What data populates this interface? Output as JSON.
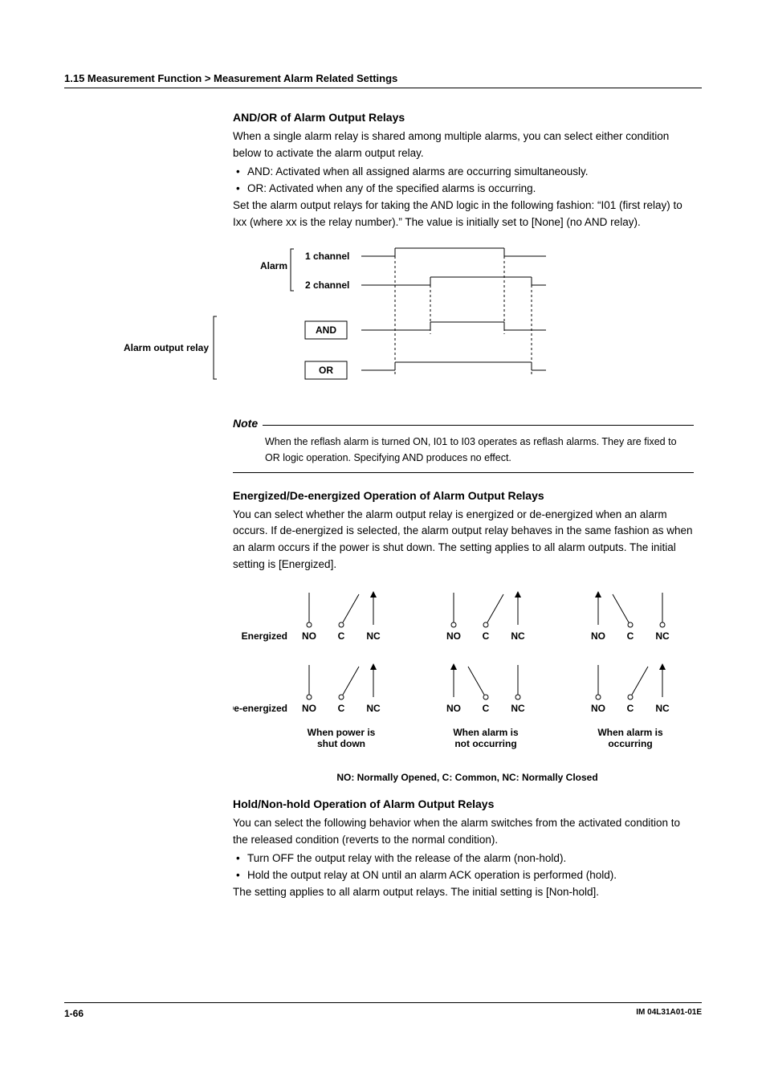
{
  "header": "1.15  Measurement Function > Measurement Alarm Related Settings",
  "s1": {
    "title": "AND/OR of Alarm Output Relays",
    "p1": "When a single alarm relay is shared among multiple alarms, you can select either condition below to activate the alarm output relay.",
    "b1": "AND: Activated when all assigned alarms are occurring simultaneously.",
    "b2": "OR: Activated when any of the specified alarms is occurring.",
    "p2": "Set the alarm output relays for taking the AND logic in the following fashion: “I01 (first relay) to Ixx (where xx is the relay number).”  The value is initially set to [None] (no AND relay)."
  },
  "d1": {
    "alarm": "Alarm",
    "ch1": "1 channel",
    "ch2": "2 channel",
    "relay": "Alarm output relay",
    "and": "AND",
    "or": "OR"
  },
  "note": {
    "title": "Note",
    "body": "When the reflash alarm is turned ON, I01 to I03 operates as reflash alarms.  They are fixed to OR logic operation.  Specifying AND produces no effect."
  },
  "s2": {
    "title": "Energized/De-energized Operation of Alarm Output Relays",
    "p1": "You can select whether the alarm output relay is energized or de-energized when an alarm occurs.  If de-energized is selected, the alarm output relay behaves in the same fashion as when an alarm occurs if the power is shut down.  The setting applies to all alarm outputs.  The initial setting is [Energized]."
  },
  "d2": {
    "energized": "Energized",
    "deenergized": "De-energized",
    "no": "NO",
    "c": "C",
    "nc": "NC",
    "cap1a": "When power is",
    "cap1b": "shut down",
    "cap2a": "When alarm is",
    "cap2b": "not occurring",
    "cap3a": "When alarm is",
    "cap3b": "occurring",
    "legend": "NO: Normally Opened, C: Common, NC: Normally Closed"
  },
  "s3": {
    "title": "Hold/Non-hold Operation of Alarm Output Relays",
    "p1": "You can select the following behavior when the alarm switches from the activated condition to the released condition (reverts to the normal condition).",
    "b1": "Turn OFF the output relay with the release of the alarm (non-hold).",
    "b2": "Hold the output relay at ON until an alarm ACK operation is performed (hold).",
    "p2": "The setting applies to all alarm output relays.  The initial setting is [Non-hold]."
  },
  "footer": {
    "page": "1-66",
    "doc": "IM 04L31A01-01E"
  }
}
